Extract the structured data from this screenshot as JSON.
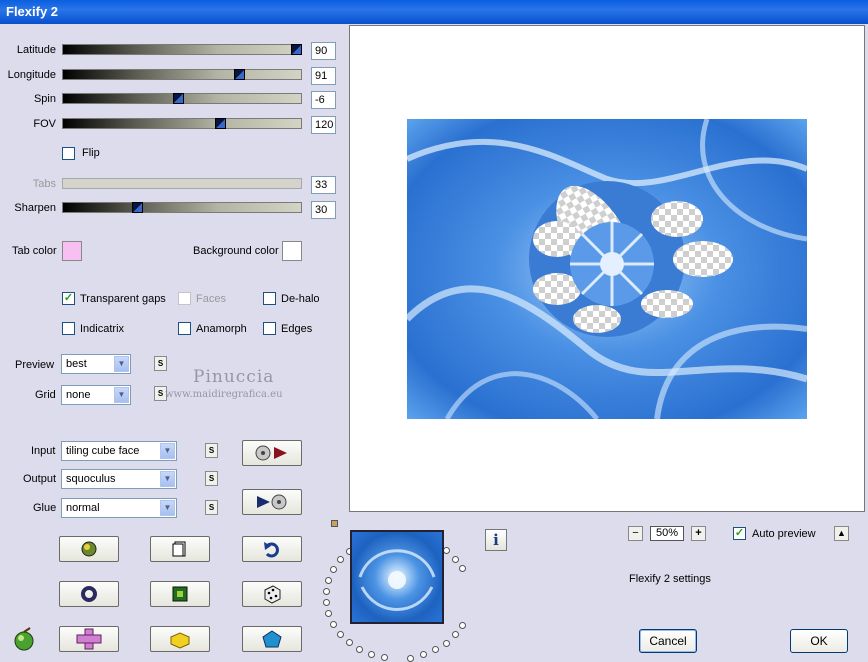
{
  "window": {
    "title": "Flexify 2"
  },
  "sliders": {
    "latitude": {
      "label": "Latitude",
      "value": "90",
      "fraction": 1.0
    },
    "longitude": {
      "label": "Longitude",
      "value": "91",
      "fraction": 0.74
    },
    "spin": {
      "label": "Spin",
      "value": "-6",
      "fraction": 0.48
    },
    "fov": {
      "label": "FOV",
      "value": "120",
      "fraction": 0.66
    },
    "tabs": {
      "label": "Tabs",
      "value": "33",
      "enabled": false
    },
    "sharpen": {
      "label": "Sharpen",
      "value": "30",
      "fraction": 0.3
    }
  },
  "flip": {
    "label": "Flip",
    "checked": false
  },
  "colors": {
    "tab_color_label": "Tab color",
    "tab_color": "#f8c0f0",
    "background_color_label": "Background color",
    "background_color": "#ffffff"
  },
  "options": {
    "transparent_gaps": {
      "label": "Transparent gaps",
      "checked": true
    },
    "faces": {
      "label": "Faces",
      "checked": false,
      "enabled": false
    },
    "de_halo": {
      "label": "De-halo",
      "checked": false
    },
    "indicatrix": {
      "label": "Indicatrix",
      "checked": false
    },
    "anamorph": {
      "label": "Anamorph",
      "checked": false
    },
    "edges": {
      "label": "Edges",
      "checked": false
    }
  },
  "dropdowns": {
    "preview": {
      "label": "Preview",
      "value": "best"
    },
    "grid": {
      "label": "Grid",
      "value": "none"
    },
    "input": {
      "label": "Input",
      "value": "tiling cube face"
    },
    "output": {
      "label": "Output",
      "value": "squoculus"
    },
    "glue": {
      "label": "Glue",
      "value": "normal"
    }
  },
  "small_button_label": "S",
  "watermark": {
    "name": "Pinuccia",
    "site": "www.maidiregrafica.eu"
  },
  "zoom": {
    "minus": "−",
    "value": "50%",
    "plus": "+"
  },
  "auto_preview": {
    "label": "Auto preview",
    "checked": true
  },
  "settings_label": "Flexify 2 settings",
  "buttons": {
    "cancel": "Cancel",
    "ok": "OK"
  },
  "colors_theme": {
    "accent": "#2a74e8",
    "panel": "#dcdcec",
    "preview_blue": "#3d8ae0"
  },
  "icons": [
    "record-icon",
    "play-icon",
    "cube-icon",
    "page-icon",
    "undo-icon",
    "ring-icon",
    "square-icon",
    "dice-icon",
    "fruit-icon",
    "cross-icon",
    "brick-icon",
    "pentagon-icon",
    "info-icon"
  ]
}
